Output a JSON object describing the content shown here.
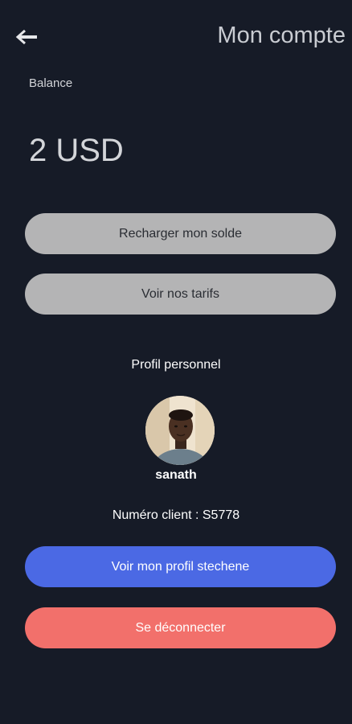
{
  "header": {
    "title": "Mon compte",
    "back_icon": "arrow-left-icon"
  },
  "balance": {
    "label": "Balance",
    "value": "2 USD"
  },
  "actions": {
    "recharge_label": "Recharger mon solde",
    "tarifs_label": "Voir nos tarifs"
  },
  "profile": {
    "section_title": "Profil personnel",
    "username": "sanath",
    "client_number": "Numéro client : S5778",
    "view_profile_label": "Voir mon profil stechene",
    "logout_label": "Se déconnecter"
  },
  "colors": {
    "background": "#161b27",
    "grey_button": "#b4b4b5",
    "profile_button": "#4b69e4",
    "logout_button": "#f2706b"
  }
}
